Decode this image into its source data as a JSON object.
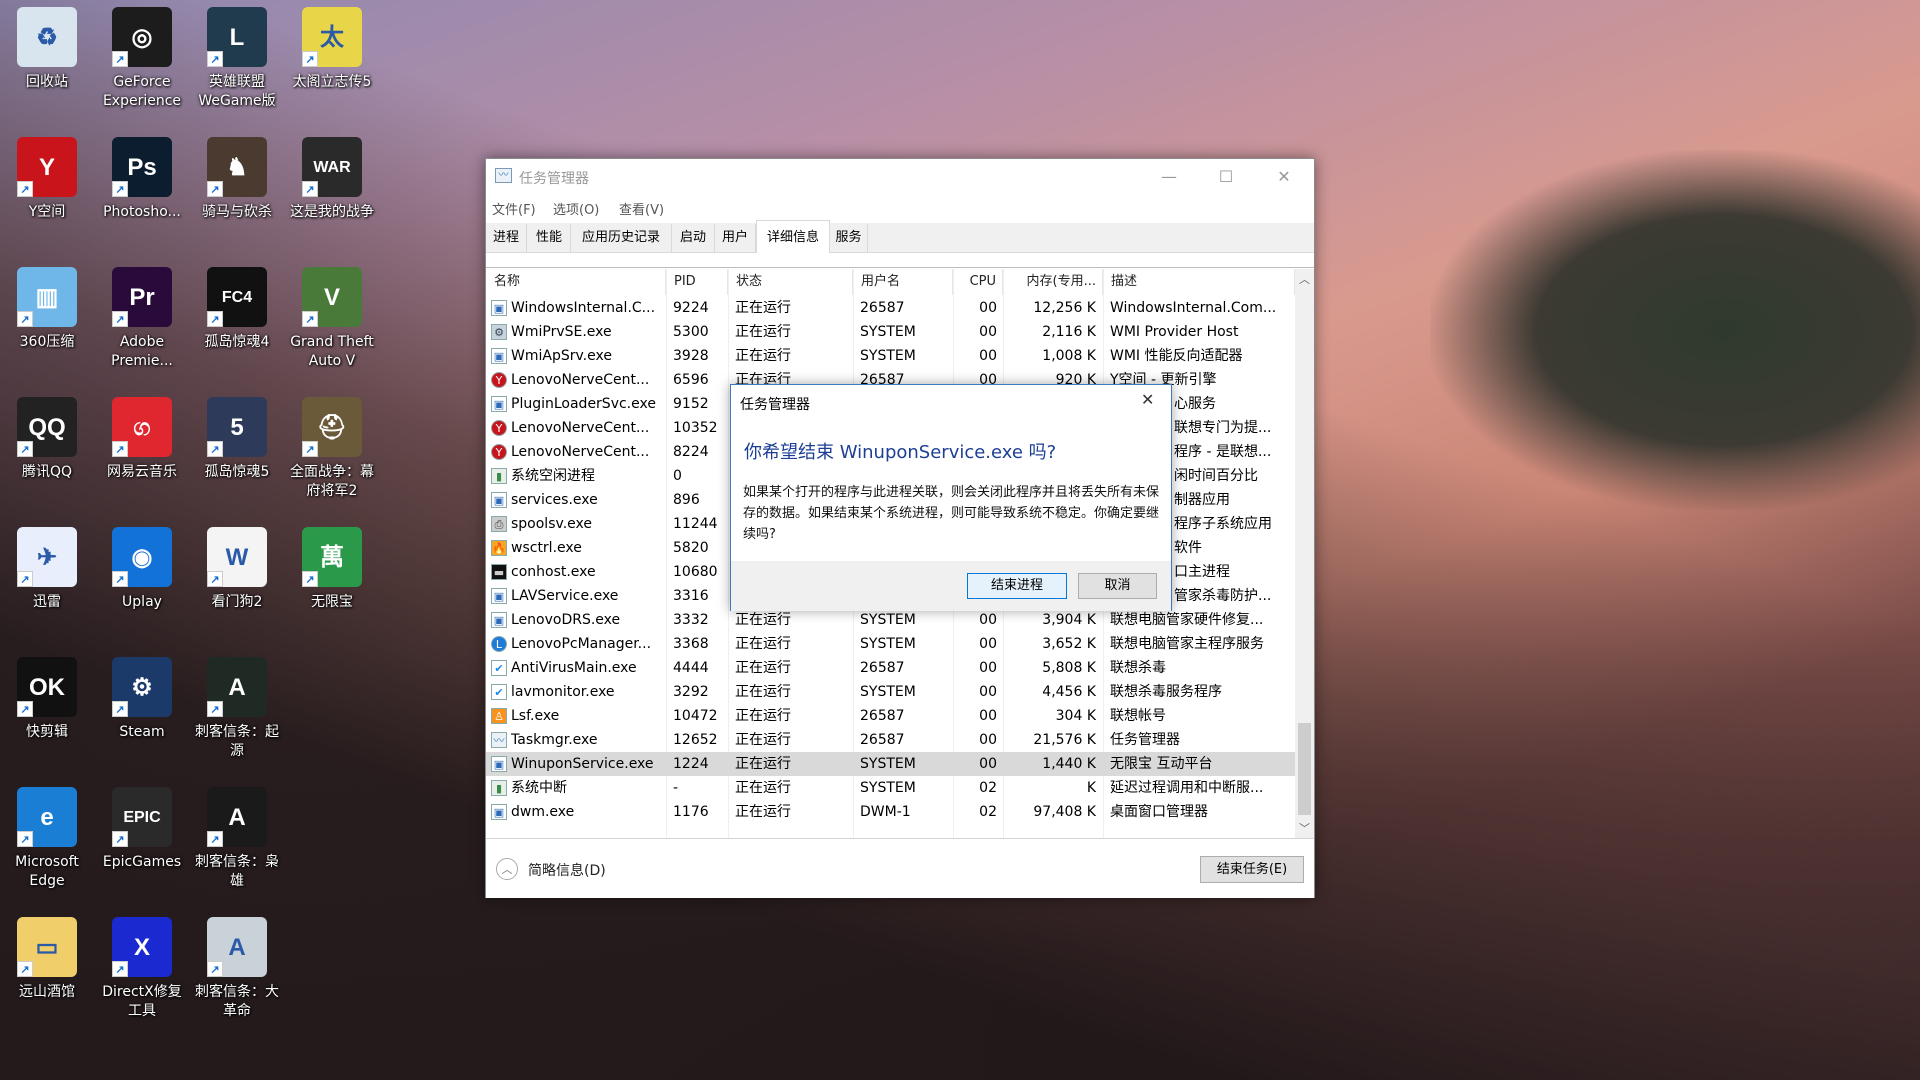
{
  "desktop": {
    "icons": [
      {
        "label": "回收站",
        "icon": "recycle-bin-icon",
        "color": "#d8e4ee",
        "glyph": "♻"
      },
      {
        "label": "GeForce Experience",
        "icon": "geforce-icon",
        "color": "#1c1c1c",
        "glyph": "◎"
      },
      {
        "label": "英雄联盟WeGame版",
        "icon": "league-of-legends-icon",
        "color": "#1f3b4d",
        "glyph": "L"
      },
      {
        "label": "太阁立志传5",
        "icon": "taikou-icon",
        "color": "#e8d648",
        "glyph": "太"
      },
      {
        "label": "Y空间",
        "icon": "lenovo-y-icon",
        "color": "#c8141a",
        "glyph": "Y"
      },
      {
        "label": "Photosho...",
        "icon": "photoshop-icon",
        "color": "#0b1d2e",
        "glyph": "Ps"
      },
      {
        "label": "骑马与砍杀",
        "icon": "mount-and-blade-icon",
        "color": "#4a3a30",
        "glyph": "♞"
      },
      {
        "label": "这是我的战争",
        "icon": "this-war-of-mine-icon",
        "color": "#2a2a2a",
        "glyph": "WAR"
      },
      {
        "label": "360压缩",
        "icon": "360-zip-icon",
        "color": "#6fb7e8",
        "glyph": "▥"
      },
      {
        "label": "Adobe Premie...",
        "icon": "premiere-icon",
        "color": "#2a0a3a",
        "glyph": "Pr"
      },
      {
        "label": "孤岛惊魂4",
        "icon": "far-cry-4-icon",
        "color": "#111",
        "glyph": "FC4"
      },
      {
        "label": "Grand Theft Auto V",
        "icon": "gta-v-icon",
        "color": "#4a7a3a",
        "glyph": "V"
      },
      {
        "label": "腾讯QQ",
        "icon": "qq-icon",
        "color": "#222",
        "glyph": "QQ"
      },
      {
        "label": "网易云音乐",
        "icon": "netease-music-icon",
        "color": "#e0262e",
        "glyph": "ග"
      },
      {
        "label": "孤岛惊魂5",
        "icon": "far-cry-5-icon",
        "color": "#2d3a5a",
        "glyph": "5"
      },
      {
        "label": "全面战争：幕府将军2",
        "icon": "shogun-2-icon",
        "color": "#6a5a3a",
        "glyph": "⛑"
      },
      {
        "label": "迅雷",
        "icon": "thunder-icon",
        "color": "#e9eefc",
        "glyph": "✈"
      },
      {
        "label": "Uplay",
        "icon": "uplay-icon",
        "color": "#1372d8",
        "glyph": "◉"
      },
      {
        "label": "看门狗2",
        "icon": "watch-dogs-2-icon",
        "color": "#f4f4f4",
        "glyph": "W"
      },
      {
        "label": "无限宝",
        "icon": "winupon-icon",
        "color": "#2a9a4a",
        "glyph": "萬"
      },
      {
        "label": "快剪辑",
        "icon": "kuaijianji-icon",
        "color": "#111",
        "glyph": "OK"
      },
      {
        "label": "Steam",
        "icon": "steam-icon",
        "color": "#1b3a6a",
        "glyph": "⚙"
      },
      {
        "label": "刺客信条：起源",
        "icon": "ac-origins-icon",
        "color": "#1f2a24",
        "glyph": "A"
      },
      {
        "label": "Microsoft Edge",
        "icon": "edge-icon",
        "color": "#1a7fd4",
        "glyph": "e"
      },
      {
        "label": "EpicGames",
        "icon": "epic-games-icon",
        "color": "#2a2a2a",
        "glyph": "EPIC"
      },
      {
        "label": "刺客信条：枭雄",
        "icon": "ac-syndicate-icon",
        "color": "#1a1a1a",
        "glyph": "A"
      },
      {
        "label": "远山酒馆",
        "icon": "folder-icon",
        "color": "#f0cf6a",
        "glyph": "▭"
      },
      {
        "label": "DirectX修复工具",
        "icon": "directx-repair-icon",
        "color": "#1a2ad0",
        "glyph": "X"
      },
      {
        "label": "刺客信条：大革命",
        "icon": "ac-unity-icon",
        "color": "#c8d2d8",
        "glyph": "A"
      }
    ]
  },
  "taskmgr": {
    "title": "任务管理器",
    "menu": [
      "文件(F)",
      "选项(O)",
      "查看(V)"
    ],
    "tabs": [
      "进程",
      "性能",
      "应用历史记录",
      "启动",
      "用户",
      "详细信息",
      "服务"
    ],
    "selected_tab": "详细信息",
    "columns": [
      "名称",
      "PID",
      "状态",
      "用户名",
      "CPU",
      "内存(专用...",
      "描述"
    ],
    "sort_indicator": "^",
    "rows": [
      {
        "icon": "app",
        "name": "WindowsInternal.C...",
        "pid": "9224",
        "status": "正在运行",
        "user": "26587",
        "cpu": "00",
        "mem": "12,256 K",
        "desc": "WindowsInternal.Com..."
      },
      {
        "icon": "wmi",
        "name": "WmiPrvSE.exe",
        "pid": "5300",
        "status": "正在运行",
        "user": "SYSTEM",
        "cpu": "00",
        "mem": "2,116 K",
        "desc": "WMI Provider Host"
      },
      {
        "icon": "app",
        "name": "WmiApSrv.exe",
        "pid": "3928",
        "status": "正在运行",
        "user": "SYSTEM",
        "cpu": "00",
        "mem": "1,008 K",
        "desc": "WMI 性能反向适配器"
      },
      {
        "icon": "lenovo",
        "name": "LenovoNerveCent...",
        "pid": "6596",
        "status": "正在运行",
        "user": "26587",
        "cpu": "00",
        "mem": "920 K",
        "desc": "Y空间 - 更新引擎"
      },
      {
        "icon": "app",
        "name": "PluginLoaderSvc.exe",
        "pid": "9152",
        "desc_fragment": "心服务"
      },
      {
        "icon": "lenovo",
        "name": "LenovoNerveCent...",
        "pid": "10352",
        "desc_fragment": "联想专门为提..."
      },
      {
        "icon": "lenovo",
        "name": "LenovoNerveCent...",
        "pid": "8224",
        "desc_fragment": "程序 - 是联想..."
      },
      {
        "icon": "idle",
        "name": "系统空闲进程",
        "pid": "0",
        "desc_fragment": "闲时间百分比"
      },
      {
        "icon": "app",
        "name": "services.exe",
        "pid": "896",
        "desc_fragment": "制器应用"
      },
      {
        "icon": "printer",
        "name": "spoolsv.exe",
        "pid": "11244",
        "desc_fragment": "程序子系统应用"
      },
      {
        "icon": "flame",
        "name": "wsctrl.exe",
        "pid": "5820",
        "desc_fragment": "软件"
      },
      {
        "icon": "console",
        "name": "conhost.exe",
        "pid": "10680",
        "desc_fragment": "口主进程"
      },
      {
        "icon": "app",
        "name": "LAVService.exe",
        "pid": "3316",
        "desc_fragment": "管家杀毒防护..."
      },
      {
        "icon": "app",
        "name": "LenovoDRS.exe",
        "pid": "3332",
        "status": "正在运行",
        "user": "SYSTEM",
        "cpu": "00",
        "mem": "3,904 K",
        "desc": "联想电脑管家硬件修复..."
      },
      {
        "icon": "lenovo-pc",
        "name": "LenovoPcManager...",
        "pid": "3368",
        "status": "正在运行",
        "user": "SYSTEM",
        "cpu": "00",
        "mem": "3,652 K",
        "desc": "联想电脑管家主程序服务"
      },
      {
        "icon": "shield",
        "name": "AntiVirusMain.exe",
        "pid": "4444",
        "status": "正在运行",
        "user": "26587",
        "cpu": "00",
        "mem": "5,808 K",
        "desc": "联想杀毒"
      },
      {
        "icon": "shield",
        "name": "lavmonitor.exe",
        "pid": "3292",
        "status": "正在运行",
        "user": "SYSTEM",
        "cpu": "00",
        "mem": "4,456 K",
        "desc": "联想杀毒服务程序"
      },
      {
        "icon": "account",
        "name": "Lsf.exe",
        "pid": "10472",
        "status": "正在运行",
        "user": "26587",
        "cpu": "00",
        "mem": "304 K",
        "desc": "联想帐号"
      },
      {
        "icon": "taskmgr",
        "name": "Taskmgr.exe",
        "pid": "12652",
        "status": "正在运行",
        "user": "26587",
        "cpu": "00",
        "mem": "21,576 K",
        "desc": "任务管理器"
      },
      {
        "icon": "app",
        "name": "WinuponService.exe",
        "pid": "1224",
        "status": "正在运行",
        "user": "SYSTEM",
        "cpu": "00",
        "mem": "1,440 K",
        "desc": "无限宝 互动平台",
        "selected": true
      },
      {
        "icon": "idle",
        "name": "系统中断",
        "pid": "-",
        "status": "正在运行",
        "user": "SYSTEM",
        "cpu": "02",
        "mem": "K",
        "desc": "延迟过程调用和中断服..."
      },
      {
        "icon": "app",
        "name": "dwm.exe",
        "pid": "1176",
        "status": "正在运行",
        "user": "DWM-1",
        "cpu": "02",
        "mem": "97,408 K",
        "desc": "桌面窗口管理器"
      }
    ],
    "footer": {
      "fewer_details": "简略信息(D)",
      "end_task": "结束任务(E)"
    }
  },
  "dialog": {
    "title": "任务管理器",
    "heading": "你希望结束 WinuponService.exe 吗?",
    "body": "如果某个打开的程序与此进程关联，则会关闭此程序并且将丢失所有未保存的数据。如果结束某个系统进程，则可能导致系统不稳定。你确定要继续吗?",
    "confirm": "结束进程",
    "cancel": "取消"
  },
  "colors": {
    "selection": "#d9d9d9",
    "dialog_heading": "#1c3f94",
    "dialog_border": "#3b79c2",
    "lenovo_red": "#c8141a"
  }
}
